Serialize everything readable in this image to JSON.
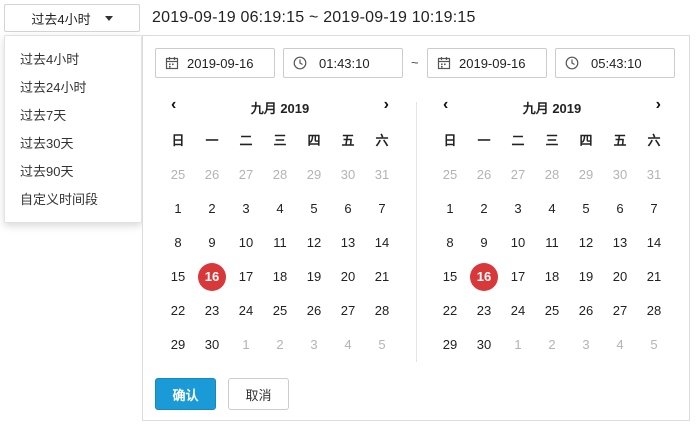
{
  "range_select": {
    "label": "过去4小时"
  },
  "range_label": "2019-09-19 06:19:15 ~ 2019-09-19 10:19:15",
  "dropdown": {
    "options": [
      "过去4小时",
      "过去24小时",
      "过去7天",
      "过去30天",
      "过去90天",
      "自定义时间段"
    ]
  },
  "inputs": {
    "start_date": "2019-09-16",
    "start_time": "01:43:10",
    "separator": "~",
    "end_date": "2019-09-16",
    "end_time": "05:43:10"
  },
  "calendars": [
    {
      "title": "九月 2019",
      "prev": "‹",
      "next": "›",
      "weekdays": [
        "日",
        "一",
        "二",
        "三",
        "四",
        "五",
        "六"
      ],
      "days": [
        [
          "25",
          "26",
          "27",
          "28",
          "29",
          "30",
          "31"
        ],
        [
          "1",
          "2",
          "3",
          "4",
          "5",
          "6",
          "7"
        ],
        [
          "8",
          "9",
          "10",
          "11",
          "12",
          "13",
          "14"
        ],
        [
          "15",
          "16",
          "17",
          "18",
          "19",
          "20",
          "21"
        ],
        [
          "22",
          "23",
          "24",
          "25",
          "26",
          "27",
          "28"
        ],
        [
          "29",
          "30",
          "1",
          "2",
          "3",
          "4",
          "5"
        ]
      ],
      "selected": "16"
    },
    {
      "title": "九月 2019",
      "prev": "‹",
      "next": "›",
      "weekdays": [
        "日",
        "一",
        "二",
        "三",
        "四",
        "五",
        "六"
      ],
      "days": [
        [
          "25",
          "26",
          "27",
          "28",
          "29",
          "30",
          "31"
        ],
        [
          "1",
          "2",
          "3",
          "4",
          "5",
          "6",
          "7"
        ],
        [
          "8",
          "9",
          "10",
          "11",
          "12",
          "13",
          "14"
        ],
        [
          "15",
          "16",
          "17",
          "18",
          "19",
          "20",
          "21"
        ],
        [
          "22",
          "23",
          "24",
          "25",
          "26",
          "27",
          "28"
        ],
        [
          "29",
          "30",
          "1",
          "2",
          "3",
          "4",
          "5"
        ]
      ],
      "selected": "16"
    }
  ],
  "buttons": {
    "confirm": "确认",
    "cancel": "取消"
  },
  "colors": {
    "accent": "#1a9ad6",
    "selected_day": "#d9383a"
  }
}
